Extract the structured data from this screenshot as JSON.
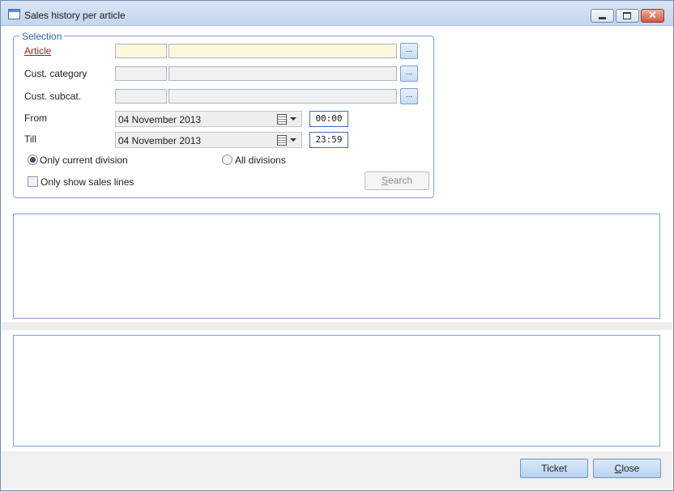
{
  "window": {
    "title": "Sales history per article",
    "icon": "window-icon"
  },
  "selection": {
    "legend": "Selection",
    "article_label": "Article",
    "cust_category_label": "Cust. category",
    "cust_subcat_label": "Cust. subcat.",
    "from_label": "From",
    "till_label": "Till",
    "from_date": "04 November 2013",
    "till_date": "04 November 2013",
    "from_time": "00:00",
    "till_time": "23:59",
    "lookup_button_label": "...",
    "radio_current": "Only current division",
    "radio_all": "All divisions",
    "radio_selected": "current",
    "checkbox_sales_lines": "Only show sales lines",
    "checkbox_checked": false,
    "search_label_underlined": "S",
    "search_label_rest": "earch"
  },
  "footer": {
    "ticket_label": "Ticket",
    "close_label_underlined": "C",
    "close_label_rest": "lose"
  }
}
